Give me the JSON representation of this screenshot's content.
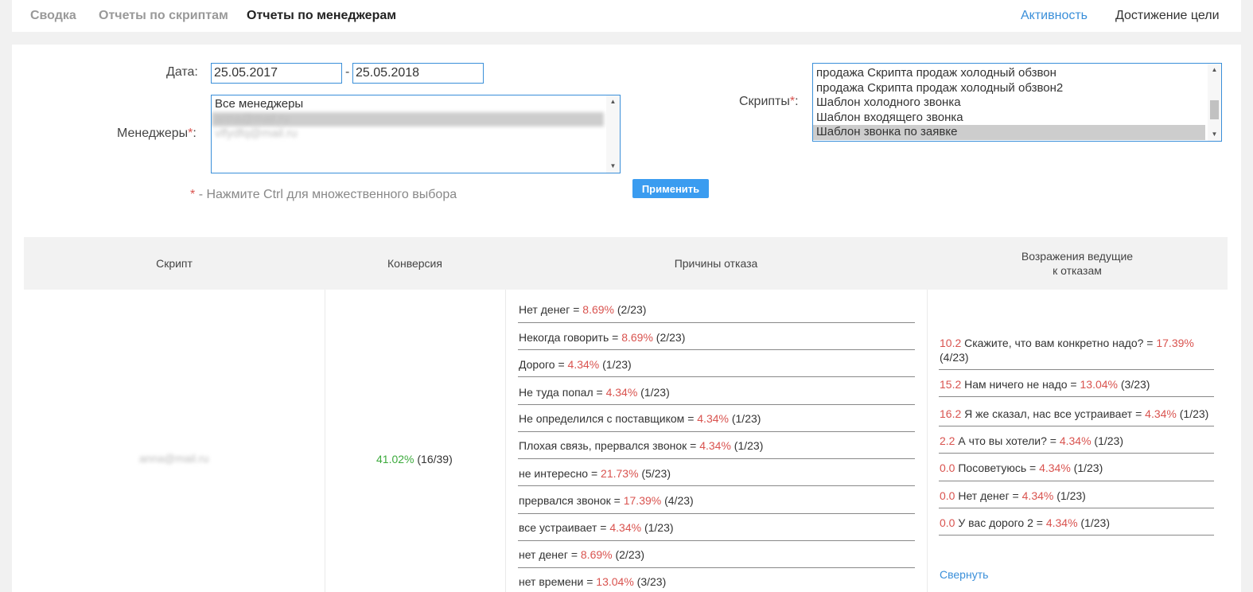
{
  "nav": {
    "tabs": [
      {
        "label": "Сводка"
      },
      {
        "label": "Отчеты по скриптам"
      },
      {
        "label": "Отчеты по менеджерам"
      }
    ],
    "right": [
      {
        "label": "Активность"
      },
      {
        "label": "Достижение цели"
      }
    ]
  },
  "colors": {
    "link": "#3a8fd9",
    "red": "#d9534f",
    "green": "#3caa3c",
    "button": "#3a9cf0"
  },
  "filters": {
    "date_label": "Дата:",
    "date_from": "25.05.2017",
    "date_to": "25.05.2018",
    "date_dash": "-",
    "managers_label": "Менеджеры",
    "managers_options": [
      {
        "label": "Все менеджеры"
      },
      {
        "label": "anna@mail.ru"
      },
      {
        "label": "vlfydfq@mail.ru"
      }
    ],
    "scripts_label": "Скрипты",
    "scripts_options": [
      {
        "label": "продажа Скрипта продаж холодный обзвон"
      },
      {
        "label": "продажа Скрипта продаж холодный обзвон2"
      },
      {
        "label": "Шаблон холодного звонка"
      },
      {
        "label": "Шаблон входящего звонка"
      },
      {
        "label": "Шаблон звонка по заявке"
      }
    ],
    "required_mark": "*",
    "hint": "- Нажмите Ctrl для множественного выбора",
    "apply_label": "Применить"
  },
  "table": {
    "headers": [
      "Скрипт",
      "Конверсия",
      "Причины отказа",
      "Возражения ведущие",
      "к отказам"
    ],
    "row": {
      "script": "anna@mail.ru",
      "conversion_pct": "41.02%",
      "conversion_ratio": "(16/39)",
      "reasons": [
        {
          "text": "Нет денег = ",
          "pct": "8.69%",
          "ratio": " (2/23)"
        },
        {
          "text": "Некогда говорить = ",
          "pct": "8.69%",
          "ratio": " (2/23)"
        },
        {
          "text": "Дорого = ",
          "pct": "4.34%",
          "ratio": " (1/23)"
        },
        {
          "text": "Не туда попал = ",
          "pct": "4.34%",
          "ratio": " (1/23)"
        },
        {
          "text": "Не определился с поставщиком = ",
          "pct": "4.34%",
          "ratio": " (1/23)"
        },
        {
          "text": "Плохая связь, прервался звонок = ",
          "pct": "4.34%",
          "ratio": " (1/23)"
        },
        {
          "text": "не интересно = ",
          "pct": "21.73%",
          "ratio": " (5/23)"
        },
        {
          "text": "прервался звонок = ",
          "pct": "17.39%",
          "ratio": " (4/23)"
        },
        {
          "text": "все устраивает = ",
          "pct": "4.34%",
          "ratio": " (1/23)"
        },
        {
          "text": "нет денег = ",
          "pct": "8.69%",
          "ratio": " (2/23)"
        },
        {
          "text": "нет времени = ",
          "pct": "13.04%",
          "ratio": " (3/23)"
        }
      ],
      "objections": [
        {
          "code": "10.2",
          "text": " Скажите, что вам конкретно надо? = ",
          "pct": "17.39%",
          "ratio": "(4/23)"
        },
        {
          "code": "15.2",
          "text": " Нам ничего не надо = ",
          "pct": "13.04%",
          "ratio": " (3/23)"
        },
        {
          "code": "16.2",
          "text": " Я же сказал, нас все устраивает = ",
          "pct": "4.34%",
          "ratio": " (1/23)"
        },
        {
          "code": "2.2",
          "text": " А что вы хотели? = ",
          "pct": "4.34%",
          "ratio": " (1/23)"
        },
        {
          "code": "0.0",
          "text": " Посоветуюсь = ",
          "pct": "4.34%",
          "ratio": " (1/23)"
        },
        {
          "code": "0.0",
          "text": " Нет денег = ",
          "pct": "4.34%",
          "ratio": " (1/23)"
        },
        {
          "code": "0.0",
          "text": " У вас дорого 2 = ",
          "pct": "4.34%",
          "ratio": " (1/23)"
        }
      ],
      "collapse_label": "Свернуть"
    }
  }
}
